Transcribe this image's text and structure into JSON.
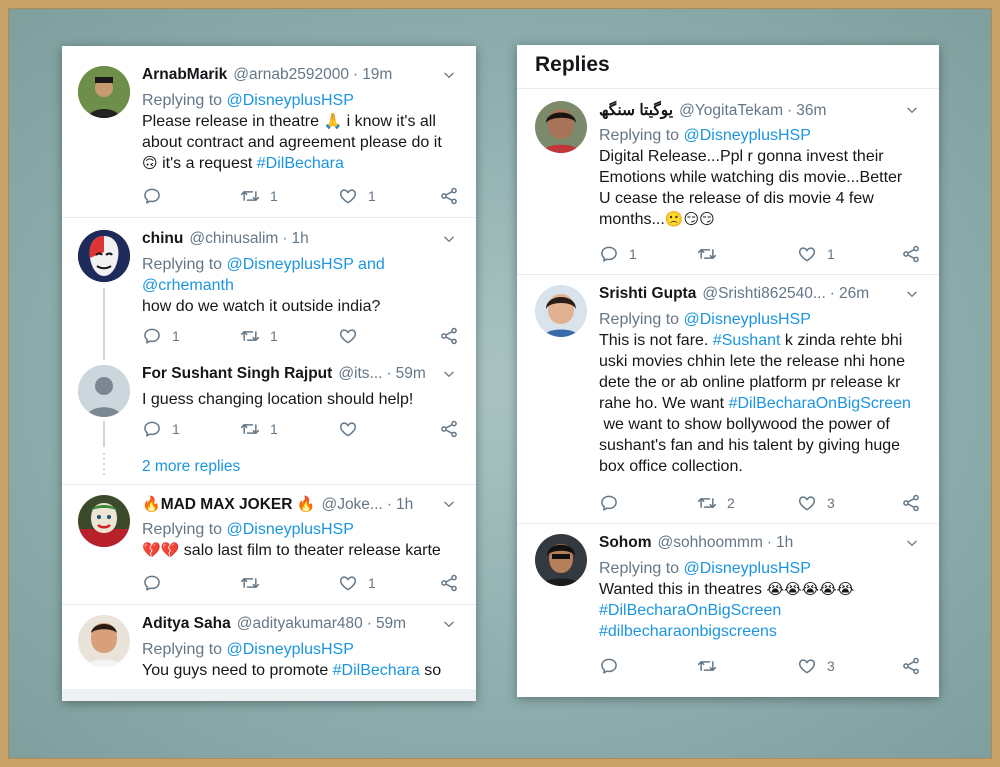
{
  "left": {
    "tweets": [
      {
        "name": "ArnabMarik",
        "handle": "@arnab2592000",
        "time": "19m",
        "reply_label": "Replying to",
        "mention": "@DisneyplusHSP",
        "line1": "Please release in theatre",
        "line1_emoji": "🙏",
        "line1b": " i know it's all",
        "line2": "about contract and agreement please do it",
        "line3_emoji": "🙃",
        "line3": " it's a request ",
        "line3_tag": "#DilBechara",
        "replies": "",
        "retweets": "1",
        "likes": "1"
      },
      {
        "name": "chinu",
        "handle": "@chinusalim",
        "time": "1h",
        "reply_label": "Replying to",
        "mention": "@DisneyplusHSP and",
        "mention2": "@crhemanth",
        "line1": "how do we watch it outside india?",
        "replies": "1",
        "retweets": "1",
        "likes": ""
      },
      {
        "name": "For Sushant Singh Rajput",
        "handle": "@its...",
        "time": "59m",
        "line1": "I guess changing location should help!",
        "replies": "1",
        "retweets": "1",
        "likes": ""
      },
      {
        "name_prefix": "🔥",
        "name": "MAD MAX JOKER ",
        "name_suffix": "🔥",
        "handle": "@Joke...",
        "time": "1h",
        "reply_label": "Replying to",
        "mention": "@DisneyplusHSP",
        "line1_emoji": "💔💔",
        "line1": " salo last  film to theater release karte",
        "replies": "",
        "retweets": "",
        "likes": "1"
      },
      {
        "name": "Aditya Saha",
        "handle": "@adityakumar480",
        "time": "59m",
        "reply_label": "Replying to",
        "mention": "@DisneyplusHSP",
        "line1": "You guys need to promote ",
        "line1_tag": "#DilBechara",
        "line1b": " so"
      }
    ],
    "more_replies": "2 more replies"
  },
  "right": {
    "header": "Replies",
    "tweets": [
      {
        "name": "یوگیتا سنگھ",
        "handle": "@YogitaTekam",
        "time": "36m",
        "reply_label": "Replying to",
        "mention": "@DisneyplusHSP",
        "line1": "Digital Release...Ppl r gonna invest their",
        "line2": "Emotions while watching dis movie...Better",
        "line3": "U cease the release of dis movie 4 few",
        "line4": "months...",
        "line4_emoji": "🙁😏😏",
        "replies": "1",
        "retweets": "",
        "likes": "1"
      },
      {
        "name": "Srishti Gupta",
        "handle": "@Srishti862540...",
        "time": "26m",
        "reply_label": "Replying to",
        "mention": "@DisneyplusHSP",
        "line1": "This is not fare. ",
        "line1_tag": "#Sushant",
        "line1b": " k zinda rehte bhi",
        "line2": "uski movies chhin lete the release nhi hone",
        "line3": "dete the or ab online platform pr release kr",
        "line4": "rahe ho. We want ",
        "line4_tag": "#DilBecharaOnBigScreen",
        "line5": " we want to show bollywood the power of",
        "line6": "sushant's fan and his talent by giving huge",
        "line7": "box office collection.",
        "replies": "",
        "retweets": "2",
        "likes": "3"
      },
      {
        "name": "Sohom",
        "handle": "@sohhoommm",
        "time": "1h",
        "reply_label": "Replying to",
        "mention": "@DisneyplusHSP",
        "line1": "Wanted this in theatres ",
        "line1_emoji": "😭😭😭😭😭",
        "line2_tag": "#DilBecharaOnBigScreen",
        "line3_tag": "#dilbecharaonbigscreens",
        "replies": "",
        "retweets": "",
        "likes": "3"
      }
    ]
  },
  "colors": {
    "link": "#1b95e0",
    "muted": "#657786",
    "text": "#14171a",
    "divider": "#e6ecf0"
  },
  "icons": [
    "reply-icon",
    "retweet-icon",
    "like-icon",
    "share-icon",
    "chevron-down-icon"
  ]
}
